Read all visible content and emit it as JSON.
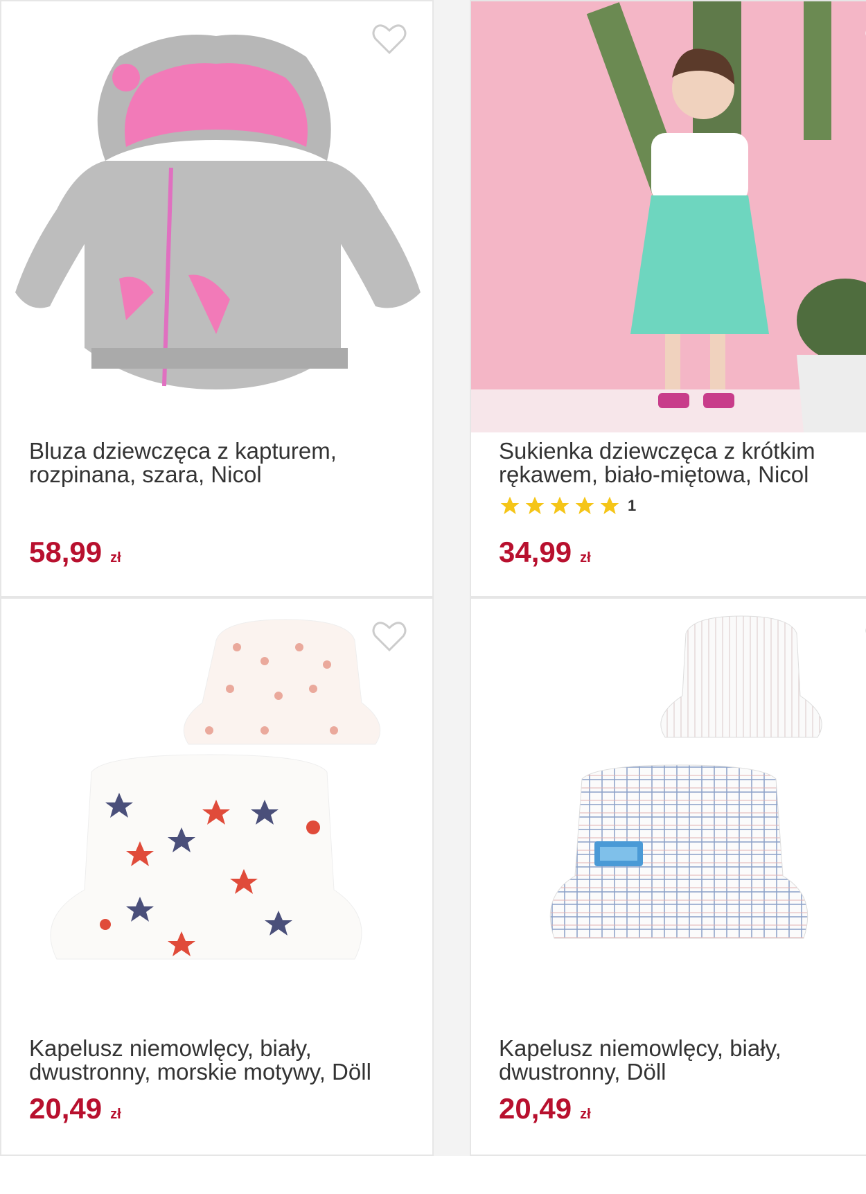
{
  "products": [
    {
      "title": "Bluza dziewczęca z kapturem, rozpinana, szara, Nicol",
      "price": "58,99",
      "currency": "zł",
      "image": "grey-hoodie-pink-ears",
      "favorite": false
    },
    {
      "title": "Sukienka dziewczęca z krótkim rękawem, biało-miętowa, Nicol",
      "price": "34,99",
      "currency": "zł",
      "rating": 5,
      "rating_count": "1",
      "image": "girl-in-mint-dress-with-cactus",
      "favorite": false
    },
    {
      "title": "Kapelusz niemowlęcy, biały, dwustronny, morskie motywy, Döll",
      "price": "20,49",
      "currency": "zł",
      "image": "white-bucket-hats-sea-motifs",
      "favorite": false
    },
    {
      "title": "Kapelusz niemowlęcy, biały, dwustronny, Döll",
      "price": "20,49",
      "currency": "zł",
      "image": "white-checked-bucket-hats",
      "favorite": false
    }
  ],
  "colors": {
    "price": "#b8102e",
    "star": "#f5c518",
    "background": "#f3f3f3"
  }
}
